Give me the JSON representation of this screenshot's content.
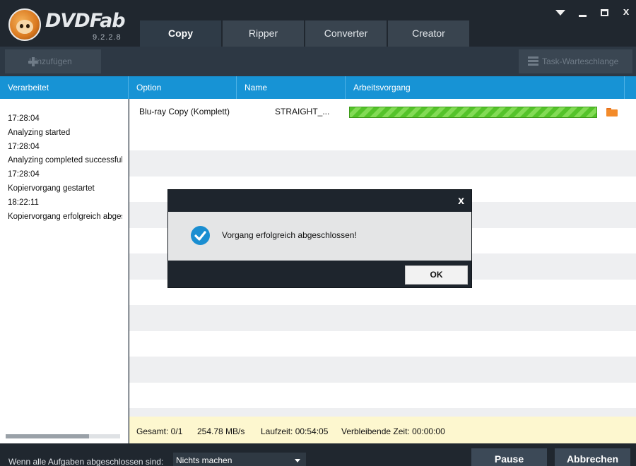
{
  "app": {
    "brand": "DVDFab",
    "version": "9.2.2.8"
  },
  "window_controls": {
    "menu": "menu",
    "minimize": "minimize",
    "maximize": "maximize",
    "close": "x"
  },
  "tabs": [
    {
      "label": "Copy",
      "active": true
    },
    {
      "label": "Ripper",
      "active": false
    },
    {
      "label": "Converter",
      "active": false
    },
    {
      "label": "Creator",
      "active": false
    }
  ],
  "toolbar": {
    "add_label": "Hinzufügen",
    "queue_label": "Task-Warteschlange"
  },
  "columns": {
    "processed": "Verarbeitet",
    "option": "Option",
    "name": "Name",
    "operation": "Arbeitsvorgang"
  },
  "log": [
    "17:28:04",
    "Analyzing started",
    "17:28:04",
    "Analyzing completed successfully",
    "17:28:04",
    "Kopiervorgang gestartet",
    "18:22:11",
    "Kopiervorgang erfolgreich abgeschlossen"
  ],
  "task": {
    "option": "Blu-ray Copy (Komplett)",
    "name": "STRAIGHT_...",
    "progress": 1.0
  },
  "status": {
    "total": "Gesamt: 0/1",
    "speed": "254.78 MB/s",
    "runtime": "Laufzeit: 00:54:05",
    "remaining": "Verbleibende Zeit: 00:00:00"
  },
  "bottom": {
    "when_done_label": "Wenn alle Aufgaben abgeschlossen sind:",
    "when_done_value": "Nichts machen",
    "pause_label": "Pause",
    "cancel_label": "Abbrechen"
  },
  "dialog": {
    "message": "Vorgang erfolgreich abgeschlossen!",
    "ok_label": "OK",
    "close_glyph": "x"
  },
  "colors": {
    "accent": "#1793d5",
    "progress": "#54c32a",
    "status_bg": "#fdf7cf"
  }
}
